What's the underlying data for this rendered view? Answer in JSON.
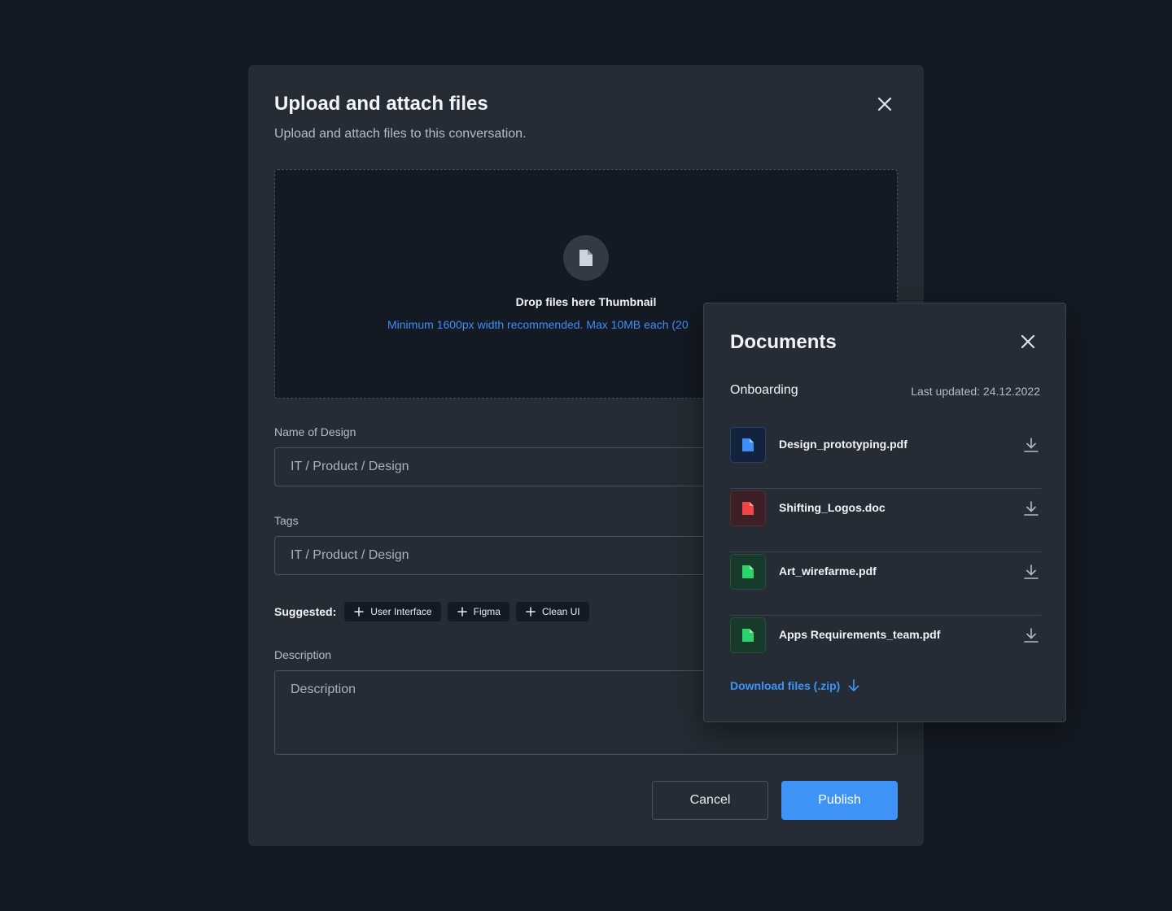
{
  "modal": {
    "title": "Upload and attach files",
    "subtitle": "Upload and attach files to this conversation.",
    "dropzone": {
      "title": "Drop files here Thumbnail",
      "hint": "Minimum 1600px width recommended. Max 10MB each (20"
    },
    "name_field": {
      "label": "Name of Design",
      "value": "IT / Product / Design"
    },
    "tags_field": {
      "label": "Tags",
      "value": "IT / Product / Design"
    },
    "suggested": {
      "label": "Suggested:",
      "chips": [
        "User Interface",
        "Figma",
        "Clean UI"
      ]
    },
    "description_field": {
      "label": "Description",
      "placeholder": "Description"
    },
    "buttons": {
      "cancel": "Cancel",
      "publish": "Publish"
    }
  },
  "documents": {
    "title": "Documents",
    "section": "Onboarding",
    "last_updated": "Last updated: 24.12.2022",
    "files": [
      {
        "name": "Design_prototyping.pdf",
        "icon": "file-icon",
        "color": "#3f8ef5",
        "bg": "#14233d"
      },
      {
        "name": "Shifting_Logos.doc",
        "icon": "file-icon",
        "color": "#f04646",
        "bg": "#3d1f26"
      },
      {
        "name": "Art_wirefarme.pdf",
        "icon": "file-icon",
        "color": "#2bd46a",
        "bg": "#173a2a"
      },
      {
        "name": "Apps Requirements_team.pdf",
        "icon": "file-icon",
        "color": "#2bd46a",
        "bg": "#173a2a"
      }
    ],
    "download_all": "Download files (.zip)"
  },
  "colors": {
    "background": "#141a24",
    "surface": "#252c35",
    "accent": "#3f93f7"
  }
}
